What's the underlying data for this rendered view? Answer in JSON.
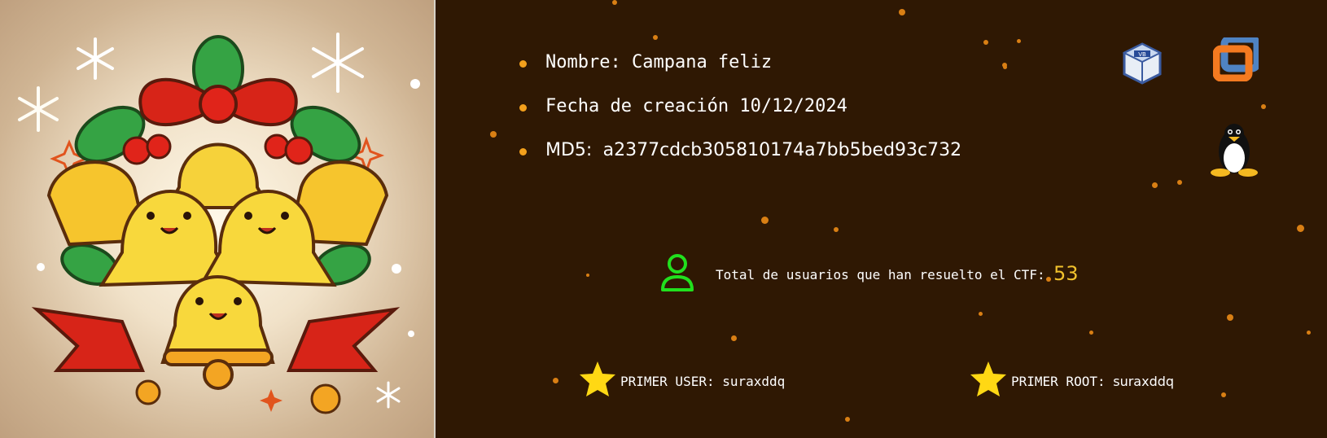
{
  "machine": {
    "name_label": "Nombre:",
    "name_value": "Campana feliz",
    "date_label": "Fecha de creación",
    "date_value": "10/12/2024",
    "md5_label": "MD5:",
    "md5_value": "a2377cdcb305810174a7bb5bed93c732"
  },
  "stats": {
    "users_label": "Total de usuarios que han resuelto el CTF:",
    "users_count": "53"
  },
  "first_bloods": {
    "user_label": "PRIMER USER:",
    "user_name": "suraxddq",
    "root_label": "PRIMER ROOT:",
    "root_name": "suraxddq"
  },
  "icons": {
    "platforms": [
      "virtualbox-icon",
      "vmware-icon",
      "linux-tux-icon"
    ],
    "user": "user-icon",
    "star": "star-icon"
  },
  "colors": {
    "background": "#2f1803",
    "accent_orange": "#f3a01c",
    "count_yellow": "#f2c22d",
    "user_icon_green": "#21e01e",
    "star_yellow": "#ffd814"
  }
}
